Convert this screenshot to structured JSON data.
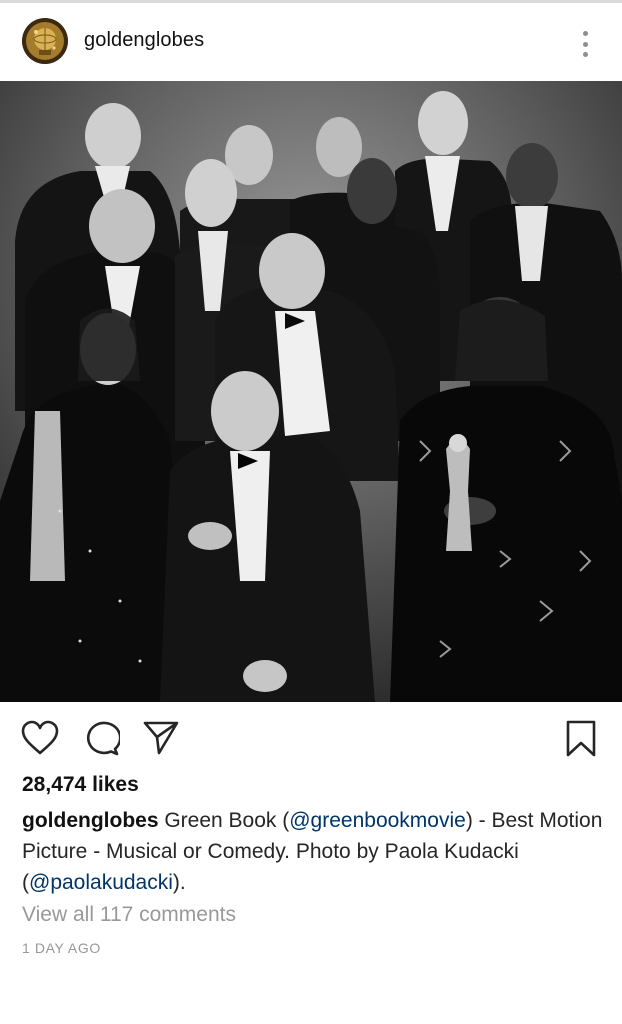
{
  "post": {
    "username": "goldenglobes",
    "likes": "28,474 likes",
    "caption": {
      "user": "goldenglobes",
      "text_1": " Green Book (",
      "mention_1": "@greenbookmovie",
      "text_2": ") - Best Motion Picture - Musical or Comedy. Photo by Paola Kudacki (",
      "mention_2": "@paolakudacki",
      "text_3": ")."
    },
    "view_comments": "View all 117 comments",
    "timestamp": "1 DAY AGO"
  },
  "icons": {
    "avatar": "golden-globe-logo",
    "more": "more-options-icon",
    "like": "heart-icon",
    "comment": "comment-icon",
    "share": "share-icon",
    "save": "bookmark-icon"
  },
  "colors": {
    "mention": "#003569",
    "muted": "#999999",
    "text": "#262626"
  }
}
